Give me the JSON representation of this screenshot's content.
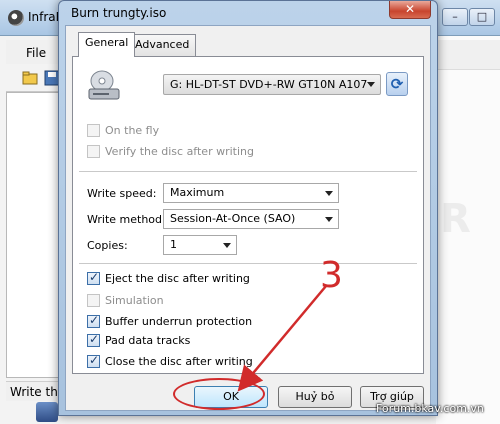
{
  "background_app": {
    "title": "InfraR",
    "menu_file": "File",
    "status_text": "Write the",
    "minimize": "–",
    "maximize": "□",
    "close": "✕"
  },
  "dialog": {
    "title": "Burn trungty.iso",
    "close_label": "✕",
    "tabs": [
      {
        "label": "General",
        "active": true
      },
      {
        "label": "Advanced",
        "active": false
      }
    ],
    "drive": {
      "selected": "G: HL-DT-ST DVD+-RW GT10N A107",
      "refresh_icon": "refresh-icon"
    },
    "top_options": [
      {
        "label": "On the fly",
        "checked": false,
        "enabled": false
      },
      {
        "label": "Verify the disc after writing",
        "checked": false,
        "enabled": false
      }
    ],
    "write_speed": {
      "label": "Write speed:",
      "value": "Maximum"
    },
    "write_method": {
      "label": "Write method:",
      "value": "Session-At-Once (SAO)"
    },
    "copies": {
      "label": "Copies:",
      "value": "1"
    },
    "bottom_options": [
      {
        "label": "Eject the disc after writing",
        "checked": true,
        "enabled": true
      },
      {
        "label": "Simulation",
        "checked": false,
        "enabled": false
      },
      {
        "label": "Buffer underrun protection",
        "checked": true,
        "enabled": true
      },
      {
        "label": "Pad data tracks",
        "checked": true,
        "enabled": true
      },
      {
        "label": "Close the disc after writing",
        "checked": true,
        "enabled": true
      }
    ],
    "buttons": {
      "ok": "OK",
      "cancel": "Huỷ bỏ",
      "help": "Trợ giúp"
    }
  },
  "annotation": {
    "step_number": "3",
    "color": "#d12b2b"
  },
  "watermark": "Forum.bkav.com.vn"
}
